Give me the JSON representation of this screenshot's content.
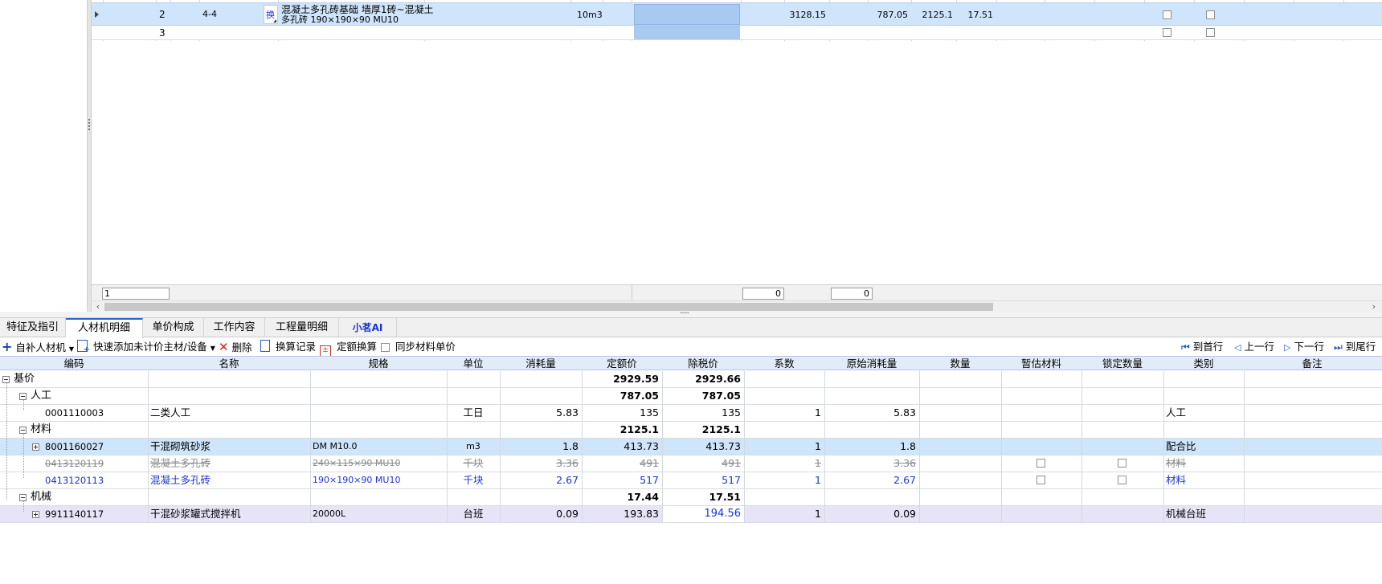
{
  "colors": {
    "accent_blue": "#1a34d6",
    "selected_row": "#cfe5fb",
    "selected_cell": "#a8c9f0",
    "lavender_row": "#e8e4f7",
    "header_bg": "#e2ecf8"
  },
  "top_grid": {
    "rows": [
      {
        "index": "2",
        "code": "4-4",
        "swap_badge": "换",
        "name_line1": "混凝土多孔砖基础 墙厚1砖~混凝土",
        "name_line2": "多孔砖 190×190×90 MU10",
        "unit": "10m3",
        "total": "3128.15",
        "labor": "787.05",
        "material": "2125.1",
        "machine": "17.51"
      },
      {
        "index": "3"
      }
    ],
    "footer": {
      "left_value": "1",
      "value_a": "0",
      "value_b": "0"
    }
  },
  "splitter_grip": "......",
  "tabs": [
    {
      "label": "特征及指引"
    },
    {
      "label": "人材机明细"
    },
    {
      "label": "单价构成"
    },
    {
      "label": "工作内容"
    },
    {
      "label": "工程量明细"
    },
    {
      "label": "小茗AI"
    }
  ],
  "toolbar": {
    "add_material": "自补人材机",
    "quick_add": "快速添加未计价主材/设备",
    "delete": "删除",
    "swap_record": "换算记录",
    "quota_swap": "定额换算",
    "sync_price": "同步材料单价",
    "first": "到首行",
    "prev": "上一行",
    "next": "下一行",
    "last": "到尾行"
  },
  "bottom_grid": {
    "headers": [
      "编码",
      "名称",
      "规格",
      "单位",
      "消耗量",
      "定额价",
      "除税价",
      "系数",
      "原始消耗量",
      "数量",
      "暂估材料",
      "锁定数量",
      "类别",
      "备注"
    ],
    "rows": [
      {
        "code": "基价",
        "quota": "2929.59",
        "taxfree": "2929.66"
      },
      {
        "code": "人工",
        "quota": "787.05",
        "taxfree": "787.05"
      },
      {
        "code": "0001110003",
        "name": "二类人工",
        "unit": "工日",
        "consume": "5.83",
        "quota": "135",
        "taxfree": "135",
        "coef": "1",
        "orig": "5.83",
        "category": "人工"
      },
      {
        "code": "材料",
        "quota": "2125.1",
        "taxfree": "2125.1"
      },
      {
        "code": "8001160027",
        "name": "干混砌筑砂浆",
        "spec": "DM M10.0",
        "unit": "m3",
        "consume": "1.8",
        "quota": "413.73",
        "taxfree": "413.73",
        "coef": "1",
        "orig": "1.8",
        "category": "配合比"
      },
      {
        "code": "0413120119",
        "name": "混凝土多孔砖",
        "spec": "240×115×90 MU10",
        "unit": "千块",
        "consume": "3.36",
        "quota": "491",
        "taxfree": "491",
        "coef": "1",
        "orig": "3.36",
        "category": "材料"
      },
      {
        "code": "0413120113",
        "name": "混凝土多孔砖",
        "spec": "190×190×90 MU10",
        "unit": "千块",
        "consume": "2.67",
        "quota": "517",
        "taxfree": "517",
        "coef": "1",
        "orig": "2.67",
        "category": "材料"
      },
      {
        "code": "机械",
        "quota": "17.44",
        "taxfree": "17.51"
      },
      {
        "code": "9911140117",
        "name": "干混砂浆罐式搅拌机",
        "spec": "20000L",
        "unit": "台班",
        "consume": "0.09",
        "quota": "193.83",
        "taxfree": "194.56",
        "coef": "1",
        "orig": "0.09",
        "category": "机械台班"
      }
    ]
  }
}
